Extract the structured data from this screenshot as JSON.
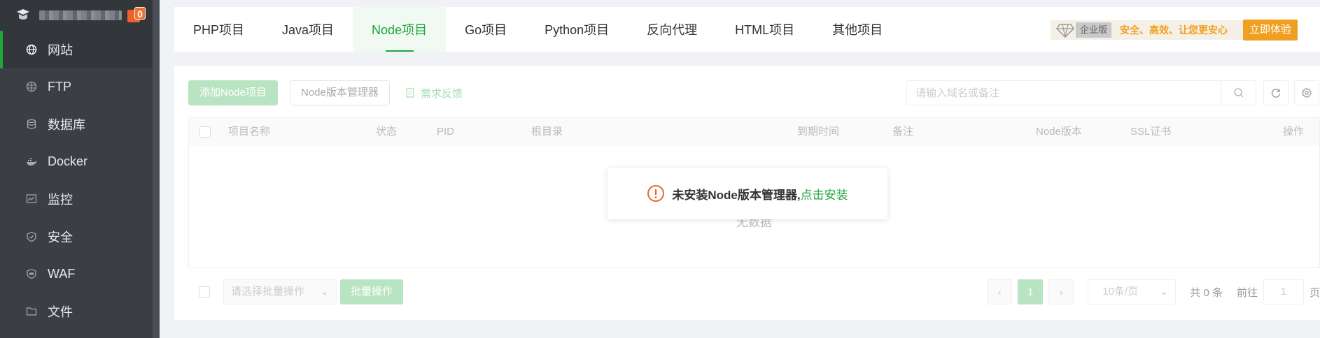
{
  "sidebar": {
    "notice_count": "0",
    "items": [
      {
        "label": "网站",
        "icon": "globe-icon"
      },
      {
        "label": "FTP",
        "icon": "ftp-icon"
      },
      {
        "label": "数据库",
        "icon": "database-icon"
      },
      {
        "label": "Docker",
        "icon": "docker-icon"
      },
      {
        "label": "监控",
        "icon": "monitor-icon"
      },
      {
        "label": "安全",
        "icon": "shield-icon"
      },
      {
        "label": "WAF",
        "icon": "waf-icon"
      },
      {
        "label": "文件",
        "icon": "folder-icon"
      }
    ]
  },
  "tabs": [
    {
      "label": "PHP项目"
    },
    {
      "label": "Java项目"
    },
    {
      "label": "Node项目"
    },
    {
      "label": "Go项目"
    },
    {
      "label": "Python项目"
    },
    {
      "label": "反向代理"
    },
    {
      "label": "HTML项目"
    },
    {
      "label": "其他项目"
    }
  ],
  "promo": {
    "badge": "企业版",
    "text": "安全、高效、让您更安心",
    "button": "立即体验"
  },
  "toolbar": {
    "add_button": "添加Node项目",
    "version_manager_button": "Node版本管理器",
    "feedback": "需求反馈",
    "search_placeholder": "请输入域名或备注"
  },
  "table": {
    "columns": [
      "项目名称",
      "状态",
      "PID",
      "根目录",
      "到期时间",
      "备注",
      "Node版本",
      "SSL证书",
      "操作"
    ],
    "empty_text": "无数据"
  },
  "alert": {
    "message": "未安装Node版本管理器,",
    "link": "点击安装"
  },
  "footer": {
    "batch_select_placeholder": "请选择批量操作",
    "batch_button": "批量操作",
    "current_page": "1",
    "page_size": "10条/页",
    "total": "共 0 条",
    "goto_label": "前往",
    "goto_value": "1",
    "page_suffix": "页"
  },
  "colors": {
    "accent": "#20a53a",
    "sidebar_bg": "#3b3f45",
    "promo": "#f0a020",
    "warning": "#e8642c"
  }
}
